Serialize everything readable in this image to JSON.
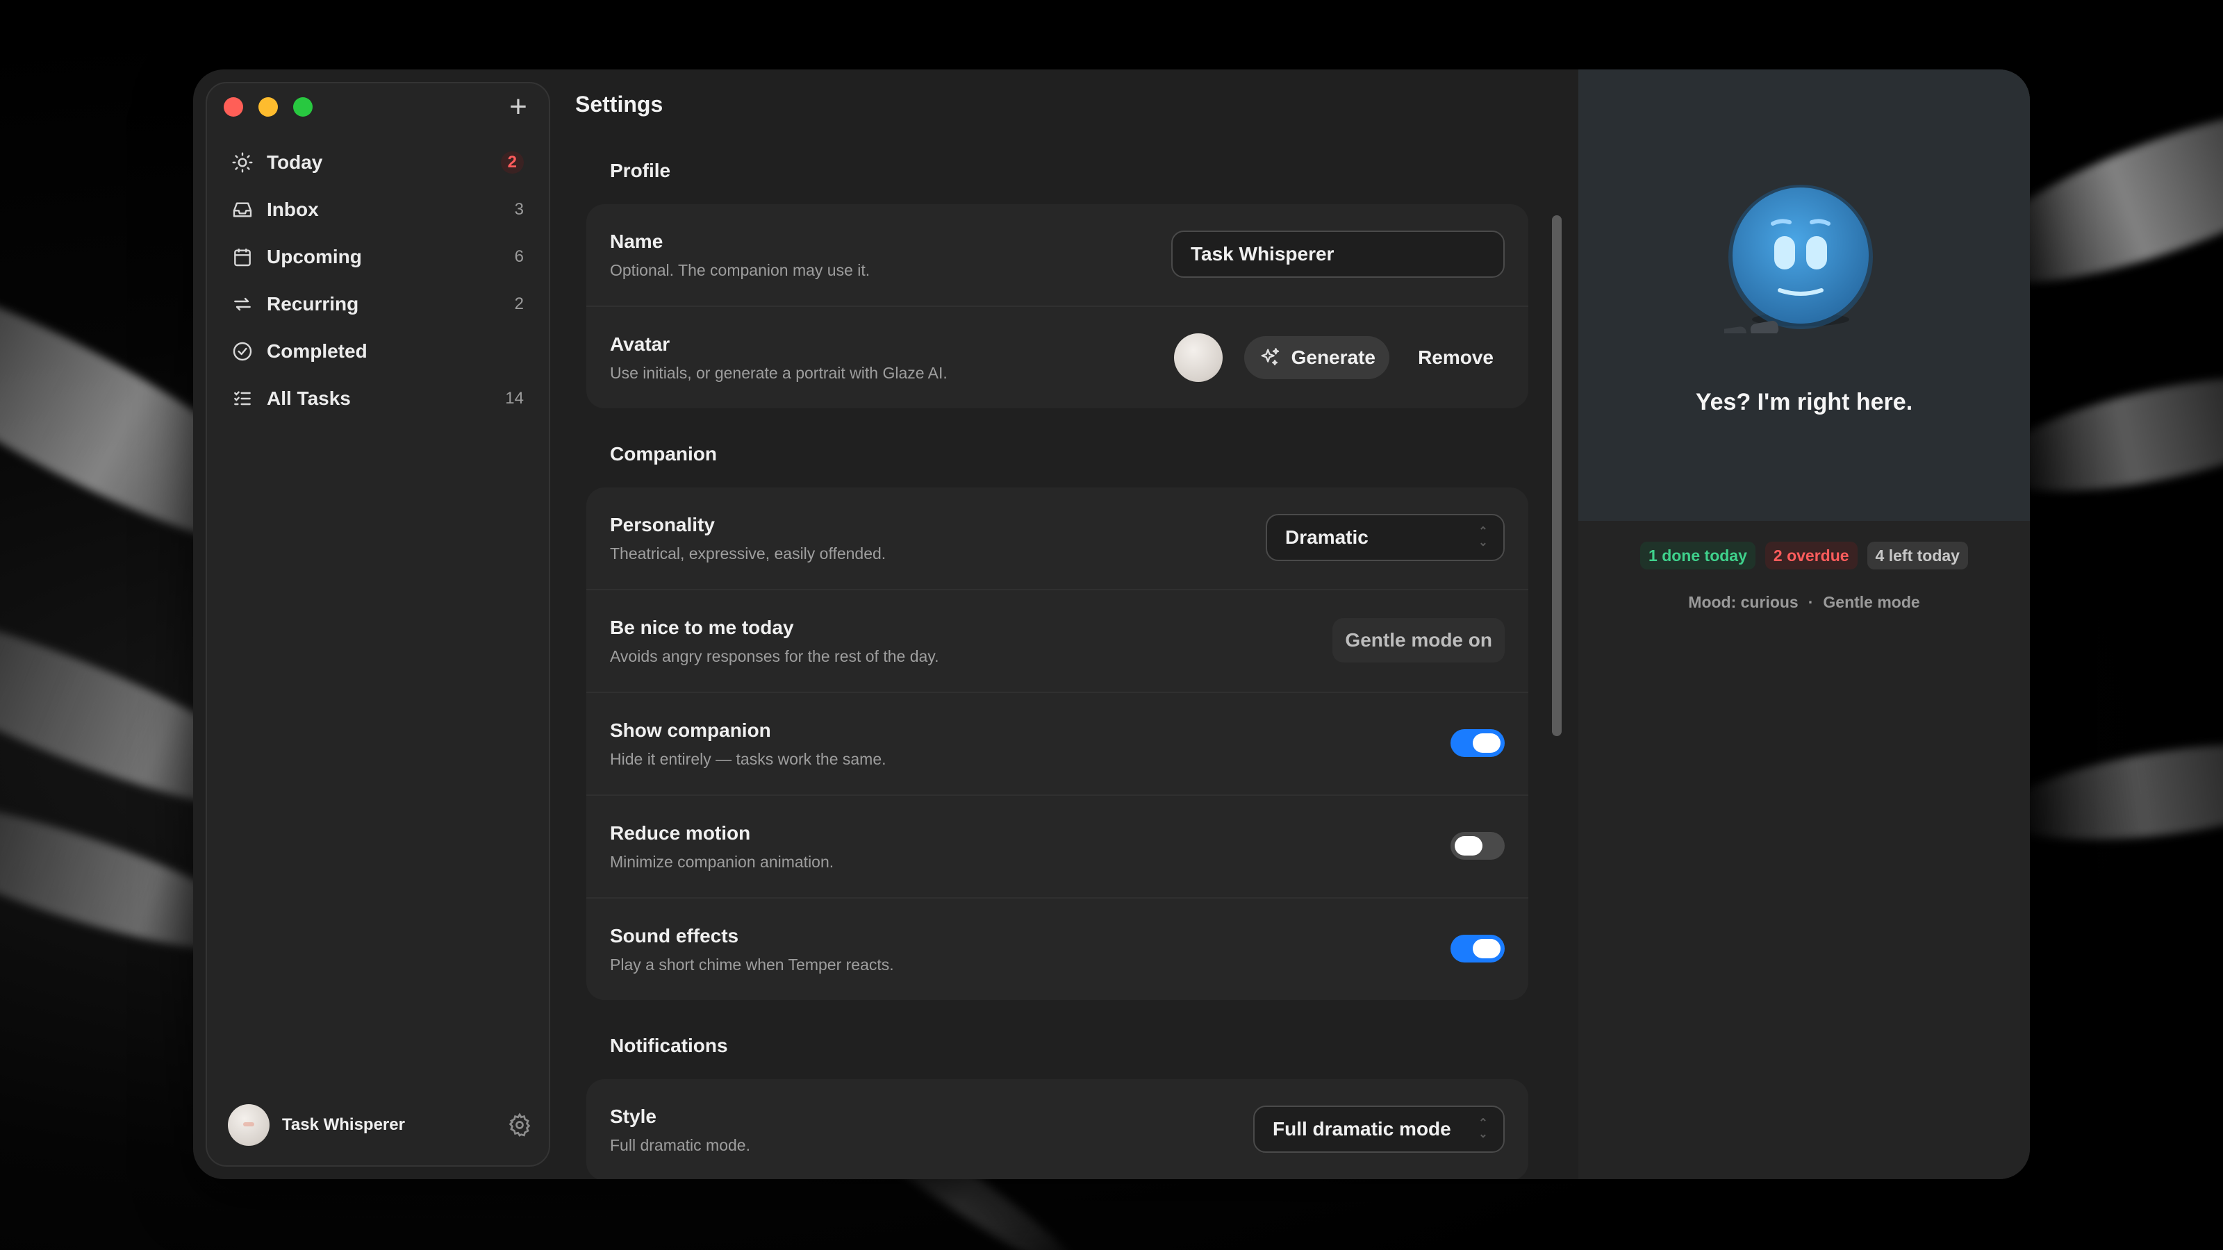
{
  "sidebar": {
    "new_label": "+",
    "items": [
      {
        "label": "Today",
        "count": "2",
        "icon": "sun-icon"
      },
      {
        "label": "Inbox",
        "count": "3",
        "icon": "inbox-icon"
      },
      {
        "label": "Upcoming",
        "count": "6",
        "icon": "calendar-icon"
      },
      {
        "label": "Recurring",
        "count": "2",
        "icon": "repeat-icon"
      },
      {
        "label": "Completed",
        "count": "",
        "icon": "check-circle-icon"
      },
      {
        "label": "All Tasks",
        "count": "14",
        "icon": "list-icon"
      }
    ],
    "user": {
      "name": "Task Whisperer"
    }
  },
  "main": {
    "title": "Settings",
    "profile": {
      "section_title": "Profile",
      "name_title": "Name",
      "name_desc": "Optional. The companion may use it.",
      "name_value": "Task Whisperer",
      "avatar_title": "Avatar",
      "avatar_desc": "Use initials, or generate a portrait with Glaze AI.",
      "generate_label": "Generate",
      "remove_label": "Remove"
    },
    "companion": {
      "section_title": "Companion",
      "personality_title": "Personality",
      "personality_desc": "Theatrical, expressive, easily offended.",
      "personality_value": "Dramatic",
      "nice_title": "Be nice to me today",
      "nice_desc": "Avoids angry responses for the rest of the day.",
      "nice_button": "Gentle mode on",
      "show_title": "Show companion",
      "show_desc": "Hide it entirely — tasks work the same.",
      "show_on": true,
      "motion_title": "Reduce motion",
      "motion_desc": "Minimize companion animation.",
      "motion_on": false,
      "sound_title": "Sound effects",
      "sound_desc": "Play a short chime when Temper reacts.",
      "sound_on": true
    },
    "notifications": {
      "section_title": "Notifications",
      "style_title": "Style",
      "style_desc": "Full dramatic mode.",
      "style_value": "Full dramatic mode"
    }
  },
  "panel": {
    "speech": "Yes? I'm right here.",
    "stats": {
      "done": "1 done today",
      "overdue": "2 overdue",
      "left": "4 left today"
    },
    "mood": "Mood: curious",
    "mode": "Gentle mode",
    "separator": "·"
  },
  "colors": {
    "accent": "#1a7cff",
    "alert": "#ff5c5c",
    "success": "#3fd18c",
    "companion": "#3a8fd0"
  }
}
